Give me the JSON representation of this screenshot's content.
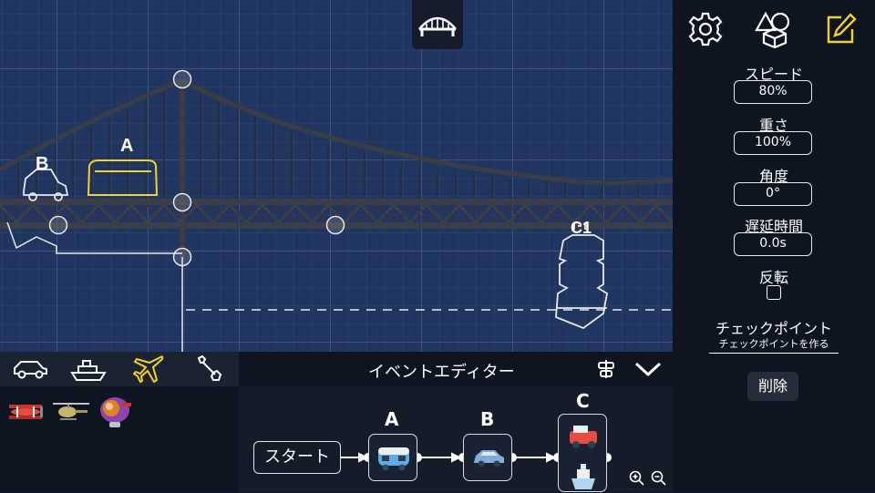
{
  "canvas": {
    "vehicle_labels": {
      "car": "A",
      "bike": "B",
      "boat": "C1"
    }
  },
  "properties": {
    "speed": {
      "label": "スピード",
      "value": "80%"
    },
    "weight": {
      "label": "重さ",
      "value": "100%"
    },
    "angle": {
      "label": "角度",
      "value": "0°"
    },
    "delay": {
      "label": "遅延時間",
      "value": "0.0s"
    },
    "reverse": {
      "label": "反転",
      "checked": false
    }
  },
  "checkpoint": {
    "title": "チェックポイント",
    "create_link": "チェックポイントを作る"
  },
  "delete_button": "削除",
  "toolbar_icons": [
    "settings-icon",
    "shapes-icon",
    "edit-icon"
  ],
  "vehicle_categories": [
    "car-icon",
    "ship-icon",
    "airplane-icon",
    "wrench-icon"
  ],
  "active_category": "airplane-icon",
  "vehicles": [
    "biplane",
    "helicopter",
    "blimp"
  ],
  "event_editor": {
    "title": "イベントエディター",
    "start_label": "スタート",
    "nodes": [
      {
        "label": "A",
        "content": [
          "van"
        ]
      },
      {
        "label": "B",
        "content": [
          "sedan"
        ]
      },
      {
        "label": "C",
        "content": [
          "jeep",
          "ship"
        ]
      }
    ]
  },
  "colors": {
    "accent": "#f2d22e",
    "canvas": "#20355f",
    "panel": "#0f1421"
  }
}
